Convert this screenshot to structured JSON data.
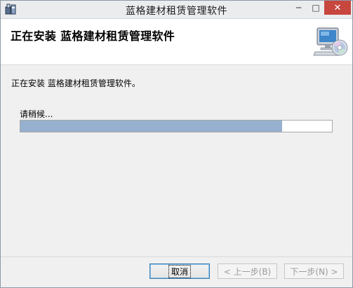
{
  "window": {
    "title": "蓝格建材租赁管理软件",
    "minimize_glyph": "─",
    "maximize_glyph": "□",
    "close_glyph": "✕"
  },
  "header": {
    "title": "正在安装 蓝格建材租赁管理软件",
    "icon": "computer-cd-icon"
  },
  "body": {
    "status_text": "正在安装 蓝格建材租赁管理软件。",
    "wait_text": "请稍候...",
    "progress": 0.84
  },
  "footer": {
    "cancel_label": "取消",
    "back_label": "< 上一步(B)",
    "next_label": "下一步(N) >"
  },
  "colors": {
    "progress_fill": "#96b0cf",
    "close_button": "#c7463e"
  }
}
